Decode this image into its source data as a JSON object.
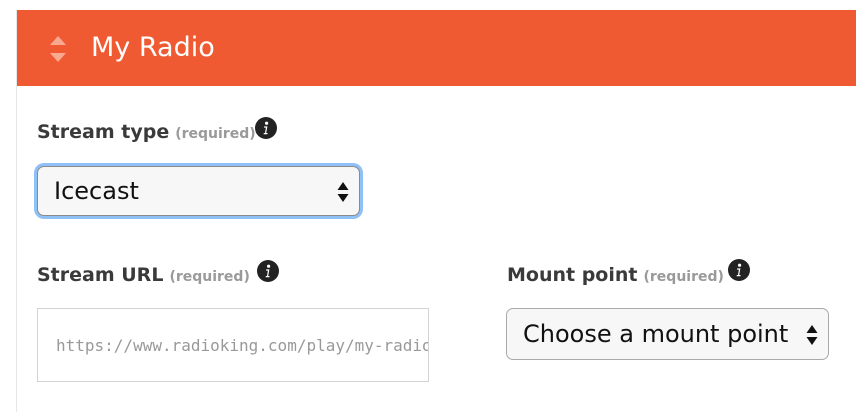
{
  "theme": {
    "accent": "#f05a32"
  },
  "header": {
    "title": "My Radio",
    "handle_icon": "sort-arrows-icon"
  },
  "stream_type": {
    "label": "Stream type",
    "required": "(required)",
    "info_icon": "info-icon",
    "selected": "Icecast"
  },
  "stream_url": {
    "label": "Stream URL",
    "required": "(required)",
    "info_icon": "info-icon",
    "placeholder": "https://www.radioking.com/play/my-radio"
  },
  "mount_point": {
    "label": "Mount point",
    "required": "(required)",
    "info_icon": "info-icon",
    "selected": "Choose a mount point"
  }
}
